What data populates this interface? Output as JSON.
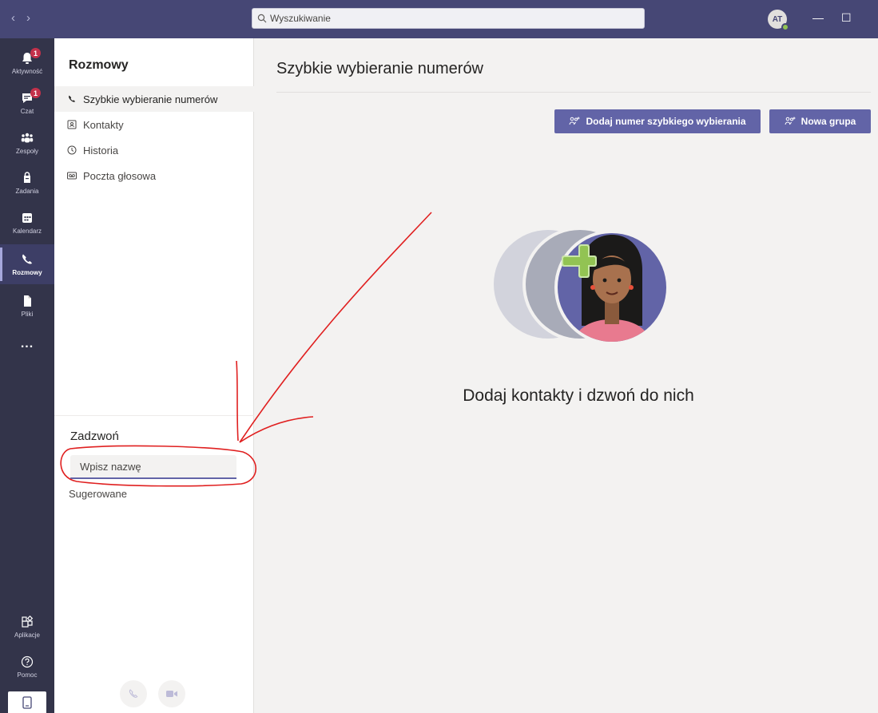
{
  "titlebar": {
    "back_label": "‹",
    "forward_label": "›",
    "search_placeholder": "Wyszukiwanie",
    "avatar_initials": "AT",
    "minimize_label": "—",
    "maximize_label": "☐"
  },
  "rail": {
    "items": [
      {
        "label": "Aktywność",
        "icon": "bell-icon",
        "badge": "1"
      },
      {
        "label": "Czat",
        "icon": "chat-icon",
        "badge": "1"
      },
      {
        "label": "Zespoły",
        "icon": "teams-icon"
      },
      {
        "label": "Zadania",
        "icon": "tasks-icon"
      },
      {
        "label": "Kalendarz",
        "icon": "calendar-icon"
      },
      {
        "label": "Rozmowy",
        "icon": "phone-icon",
        "active": true
      },
      {
        "label": "Pliki",
        "icon": "file-icon"
      },
      {
        "label": "...",
        "icon": "more-icon"
      },
      {
        "label": "Aplikacje",
        "icon": "apps-icon"
      },
      {
        "label": "Pomoc",
        "icon": "help-icon"
      }
    ]
  },
  "panel": {
    "title": "Rozmowy",
    "nav": [
      {
        "label": "Szybkie wybieranie numerów",
        "icon": "phone-icon",
        "selected": true
      },
      {
        "label": "Kontakty",
        "icon": "contacts-icon"
      },
      {
        "label": "Historia",
        "icon": "history-icon"
      },
      {
        "label": "Poczta głosowa",
        "icon": "voicemail-icon"
      }
    ],
    "call": {
      "title": "Zadzwoń",
      "input_placeholder": "Wpisz nazwę",
      "suggested_label": "Sugerowane"
    }
  },
  "main": {
    "title": "Szybkie wybieranie numerów",
    "add_speed_dial_label": "Dodaj numer szybkiego wybierania",
    "new_group_label": "Nowa grupa",
    "empty_state_text": "Dodaj kontakty i dzwoń do nich"
  },
  "colors": {
    "brand": "#6264a7",
    "titlebar": "#464775",
    "rail": "#33344a",
    "badge": "#c4314b",
    "annotation": "#e02020"
  }
}
